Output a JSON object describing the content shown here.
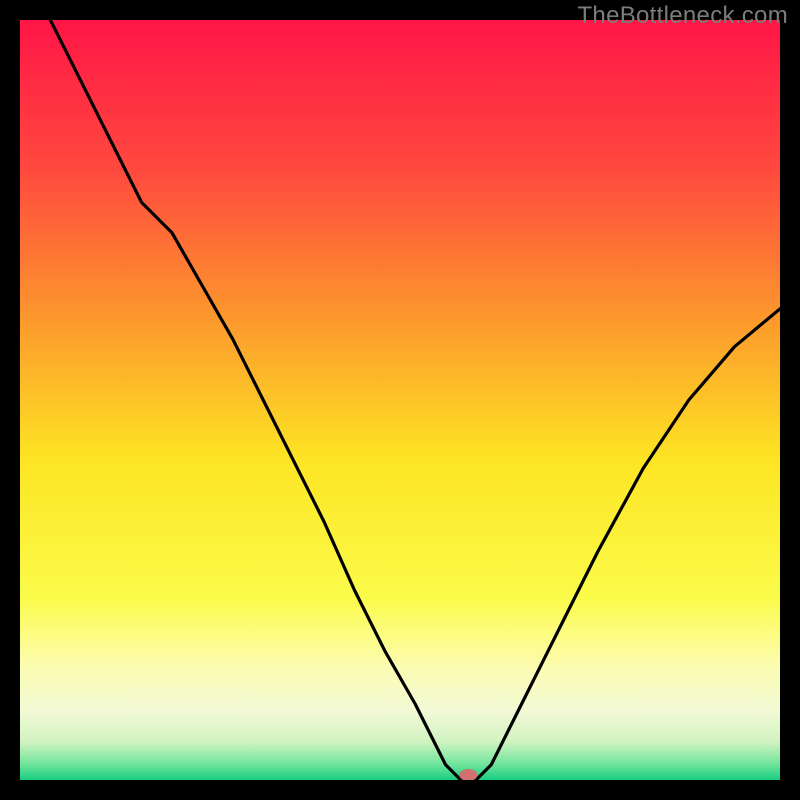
{
  "watermark": "TheBottleneck.com",
  "chart_data": {
    "type": "line",
    "title": "",
    "xlabel": "",
    "ylabel": "",
    "xlim": [
      0,
      100
    ],
    "ylim": [
      0,
      100
    ],
    "grid": false,
    "legend": false,
    "series": [
      {
        "name": "curve",
        "x": [
          4,
          8,
          12,
          16,
          20,
          24,
          28,
          32,
          36,
          40,
          44,
          48,
          52,
          56,
          58,
          60,
          62,
          66,
          70,
          76,
          82,
          88,
          94,
          100
        ],
        "values": [
          100,
          92,
          84,
          76,
          72,
          65,
          58,
          50,
          42,
          34,
          25,
          17,
          10,
          2,
          0,
          0,
          2,
          10,
          18,
          30,
          41,
          50,
          57,
          62
        ]
      }
    ],
    "optimum_point": {
      "x": 59,
      "y": 0
    },
    "gradient_stops": [
      {
        "offset": 0,
        "color": "#ff1547"
      },
      {
        "offset": 20,
        "color": "#ff4a3e"
      },
      {
        "offset": 40,
        "color": "#fc9b2c"
      },
      {
        "offset": 58,
        "color": "#fde524"
      },
      {
        "offset": 76,
        "color": "#fbfb4a"
      },
      {
        "offset": 85,
        "color": "#fcfcb0"
      },
      {
        "offset": 91,
        "color": "#f2f9d6"
      },
      {
        "offset": 95,
        "color": "#d0f3c0"
      },
      {
        "offset": 98,
        "color": "#6de49b"
      },
      {
        "offset": 100,
        "color": "#18cd80"
      }
    ]
  }
}
